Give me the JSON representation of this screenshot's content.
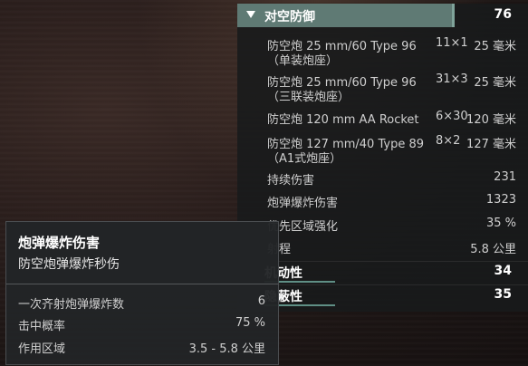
{
  "aa_section": {
    "title": "对空防御",
    "value": "76",
    "guns": [
      {
        "name": "防空炮 25 mm/60 Type 96",
        "count": "11×1",
        "range": "25 毫米",
        "sub": "（单装炮座）"
      },
      {
        "name": "防空炮 25 mm/60 Type 96",
        "count": "31×3",
        "range": "25 毫米",
        "sub": "（三联装炮座）"
      },
      {
        "name": "防空炮 120 mm AA Rocket",
        "count": "6×30",
        "range": "120 毫米",
        "sub": ""
      },
      {
        "name": "防空炮 127 mm/40 Type 89",
        "count": "8×2",
        "range": "127 毫米",
        "sub": "（A1式炮座）"
      }
    ],
    "stats": [
      {
        "label": "持续伤害",
        "value": "231"
      },
      {
        "label": "炮弹爆炸伤害",
        "value": "1323"
      },
      {
        "label": "优先区域强化",
        "value": "35 %"
      },
      {
        "label": "射程",
        "value": "5.8 公里"
      }
    ]
  },
  "sections": [
    {
      "label": "机动性",
      "value": "34"
    },
    {
      "label": "隐蔽性",
      "value": "35"
    }
  ],
  "tooltip": {
    "title": "炮弹爆炸伤害",
    "subtitle": "防空炮弹爆炸秒伤",
    "rows": [
      {
        "label": "一次齐射炮弹爆炸数",
        "value": "6"
      },
      {
        "label": "击中概率",
        "value": "75 %"
      },
      {
        "label": "作用区域",
        "value": "3.5 - 5.8 公里"
      }
    ]
  },
  "colors": {
    "header_bar": "#5f7a74",
    "accent": "#7fa39a",
    "panel_bg": "#181a1b"
  }
}
